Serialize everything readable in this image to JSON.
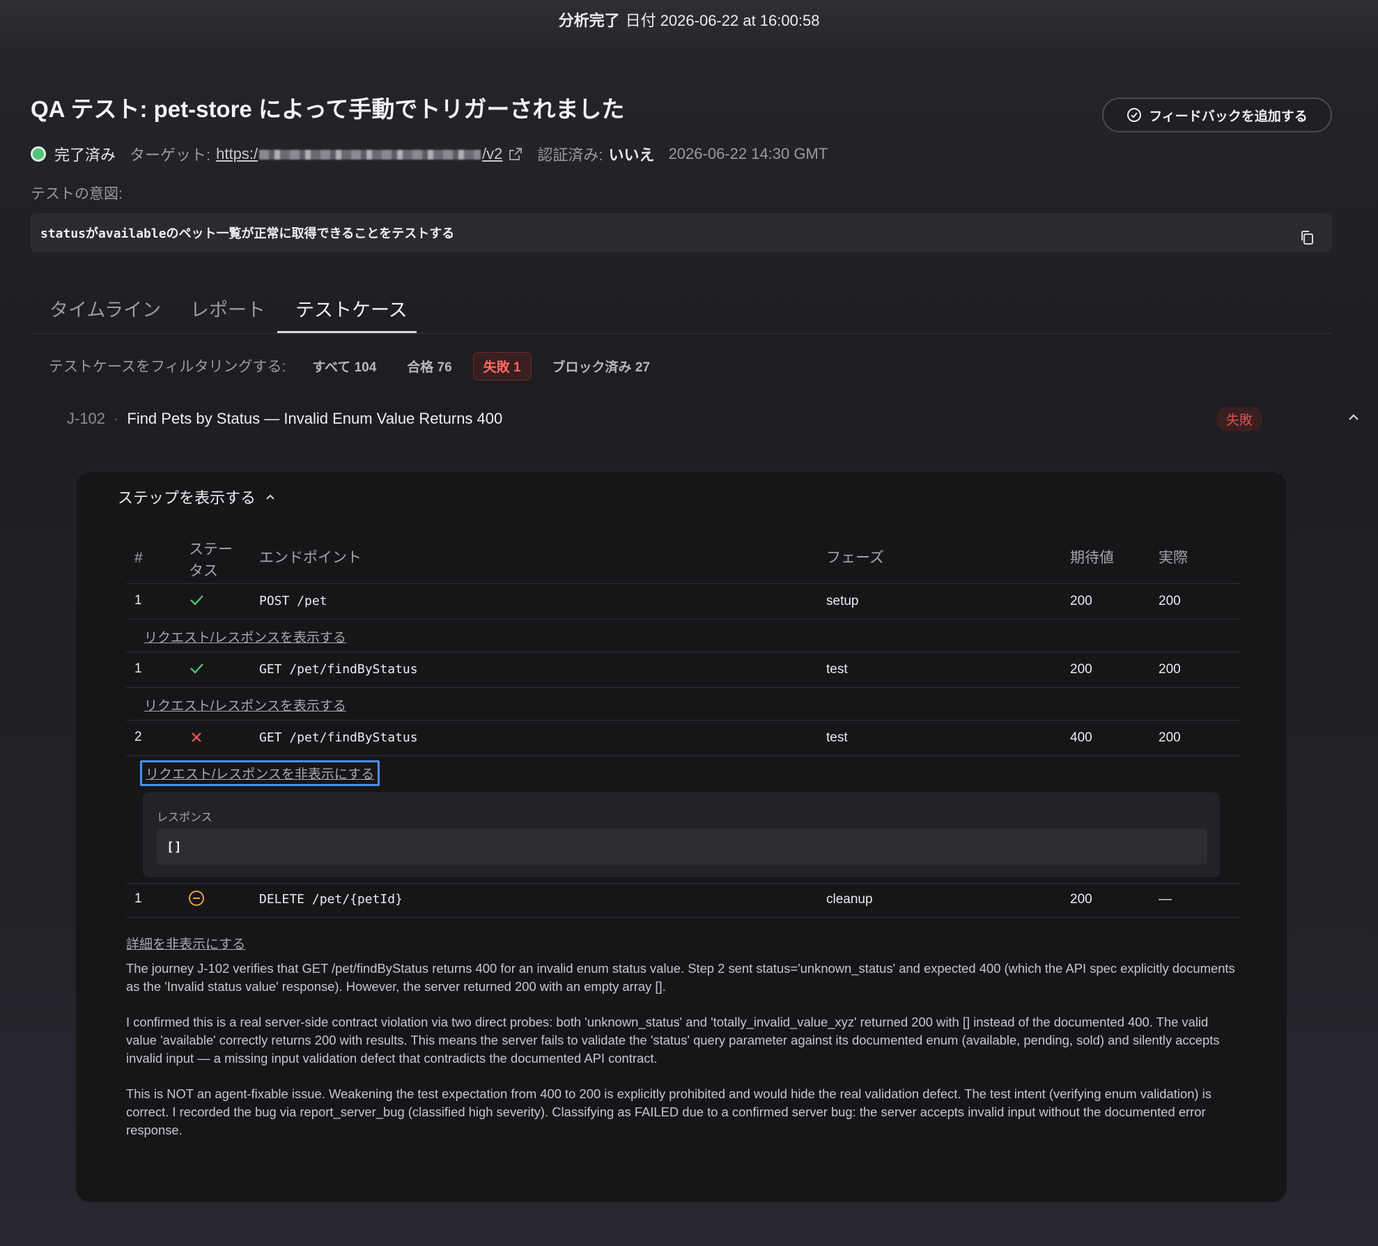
{
  "topbar": {
    "status": "分析完了",
    "date_label": "日付 2026-06-22 at 16:00:58"
  },
  "header": {
    "title": "QA テスト: pet-store によって手動でトリガーされました",
    "feedback_button": "フィードバックを追加する"
  },
  "meta": {
    "status": "完了済み",
    "target_label": "ターゲット:",
    "target_url_start": "https:/",
    "target_url_end": "/v2",
    "auth_label": "認証済み:",
    "auth_value": "いいえ",
    "timestamp": "2026-06-22 14:30 GMT"
  },
  "intent": {
    "label": "テストの意図:",
    "text": "statusがavailableのペット一覧が正常に取得できることをテストする"
  },
  "tabs": [
    {
      "label": "タイムライン"
    },
    {
      "label": "レポート"
    },
    {
      "label": "テストケース"
    }
  ],
  "filter": {
    "label": "テストケースをフィルタリングする:",
    "chips": [
      {
        "label": "すべて 104"
      },
      {
        "label": "合格 76"
      },
      {
        "label": "失敗 1"
      },
      {
        "label": "ブロック済み 27"
      }
    ]
  },
  "case": {
    "id": "J-102",
    "separator": "·",
    "title": "Find Pets by Status — Invalid Enum Value Returns 400",
    "status": "失敗"
  },
  "steps": {
    "toggle_label": "ステップを表示する",
    "headers": {
      "num": "#",
      "status": "ステー\nタス",
      "endpoint": "エンドポイント",
      "phase": "フェーズ",
      "expected": "期待値",
      "actual": "実際"
    },
    "rows": [
      {
        "num": "1",
        "status": "pass",
        "endpoint": "POST /pet",
        "phase": "setup",
        "expected": "200",
        "actual": "200",
        "link": "リクエスト/レスポンスを表示する"
      },
      {
        "num": "1",
        "status": "pass",
        "endpoint": "GET /pet/findByStatus",
        "phase": "test",
        "expected": "200",
        "actual": "200",
        "link": "リクエスト/レスポンスを表示する"
      },
      {
        "num": "2",
        "status": "fail",
        "endpoint": "GET /pet/findByStatus",
        "phase": "test",
        "expected": "400",
        "actual": "200",
        "link": "リクエスト/レスポンスを非表示にする"
      },
      {
        "num": "1",
        "status": "skipped",
        "endpoint": "DELETE /pet/{petId}",
        "phase": "cleanup",
        "expected": "200",
        "actual": "—"
      }
    ],
    "response": {
      "label": "レスポンス",
      "body": "[]"
    }
  },
  "details": {
    "toggle_label": "詳細を非表示にする",
    "paragraphs": [
      "The journey J-102 verifies that GET /pet/findByStatus returns 400 for an invalid enum status value. Step 2 sent status='unknown_status' and expected 400 (which the API spec explicitly documents as the 'Invalid status value' response). However, the server returned 200 with an empty array [].",
      "I confirmed this is a real server-side contract violation via two direct probes: both 'unknown_status' and 'totally_invalid_value_xyz' returned 200 with [] instead of the documented 400. The valid value 'available' correctly returns 200 with results. This means the server fails to validate the 'status' query parameter against its documented enum (available, pending, sold) and silently accepts invalid input — a missing input validation defect that contradicts the documented API contract.",
      "This is NOT an agent-fixable issue. Weakening the test expectation from 400 to 200 is explicitly prohibited and would hide the real validation defect. The test intent (verifying enum validation) is correct. I recorded the bug via report_server_bug (classified high severity). Classifying as FAILED due to a confirmed server bug: the server accepts invalid input without the documented error response."
    ]
  },
  "colors": {
    "pass": "#4cc46a",
    "fail": "#ff5a4e",
    "skipped": "#e8a33a",
    "accent_focus": "#4c8ff0"
  }
}
